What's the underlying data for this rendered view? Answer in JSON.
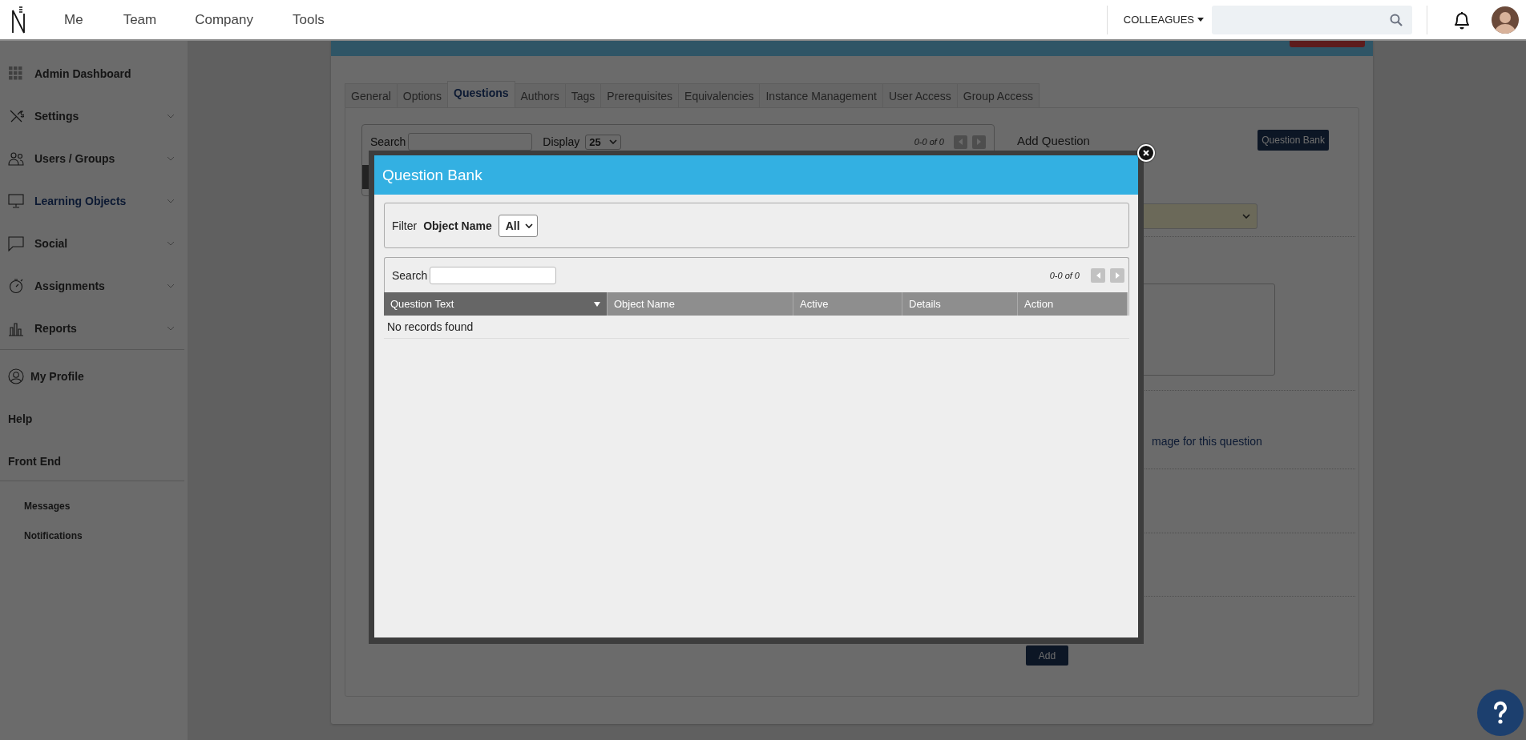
{
  "topbar": {
    "nav": [
      "Me",
      "Team",
      "Company",
      "Tools"
    ],
    "colleagues_menu": "COLLEAGUES"
  },
  "sidebar": {
    "main_items": [
      {
        "label": "Admin Dashboard",
        "selected": false,
        "expandable": false
      },
      {
        "label": "Settings",
        "selected": false,
        "expandable": true
      },
      {
        "label": "Users / Groups",
        "selected": false,
        "expandable": true
      },
      {
        "label": "Learning Objects",
        "selected": true,
        "expandable": true
      },
      {
        "label": "Social",
        "selected": false,
        "expandable": true
      },
      {
        "label": "Assignments",
        "selected": false,
        "expandable": true
      },
      {
        "label": "Reports",
        "selected": false,
        "expandable": true
      }
    ],
    "account_items": [
      {
        "label": "My Profile",
        "selected": false
      },
      {
        "label": "Help",
        "selected": false
      },
      {
        "label": "Front End",
        "selected": false
      }
    ],
    "footer_links": [
      "Messages",
      "Notifications"
    ]
  },
  "page": {
    "tabs": [
      {
        "label": "General",
        "selected": false
      },
      {
        "label": "Options",
        "selected": false
      },
      {
        "label": "Questions",
        "selected": true
      },
      {
        "label": "Authors",
        "selected": false
      },
      {
        "label": "Tags",
        "selected": false
      },
      {
        "label": "Prerequisites",
        "selected": false
      },
      {
        "label": "Equivalencies",
        "selected": false
      },
      {
        "label": "Instance Management",
        "selected": false
      },
      {
        "label": "User Access",
        "selected": false
      },
      {
        "label": "Group Access",
        "selected": false
      }
    ],
    "list_panel": {
      "search_label": "Search",
      "display_label": "Display",
      "display_value": "25",
      "pager": "0-0 of 0"
    },
    "add_question": {
      "title": "Add Question",
      "question_bank_button": "Question Bank",
      "image_hint": "mage for this question",
      "add_button": "Add"
    }
  },
  "modal": {
    "title": "Question Bank",
    "filter": {
      "label": "Filter",
      "field_label": "Object Name",
      "value": "All"
    },
    "search_label": "Search",
    "pager": "0-0 of 0",
    "columns": [
      {
        "label": "Question Text",
        "sorted": true
      },
      {
        "label": "Object Name",
        "sorted": false
      },
      {
        "label": "Active",
        "sorted": false
      },
      {
        "label": "Details",
        "sorted": false
      },
      {
        "label": "Action",
        "sorted": false
      }
    ],
    "empty_message": "No records found"
  }
}
